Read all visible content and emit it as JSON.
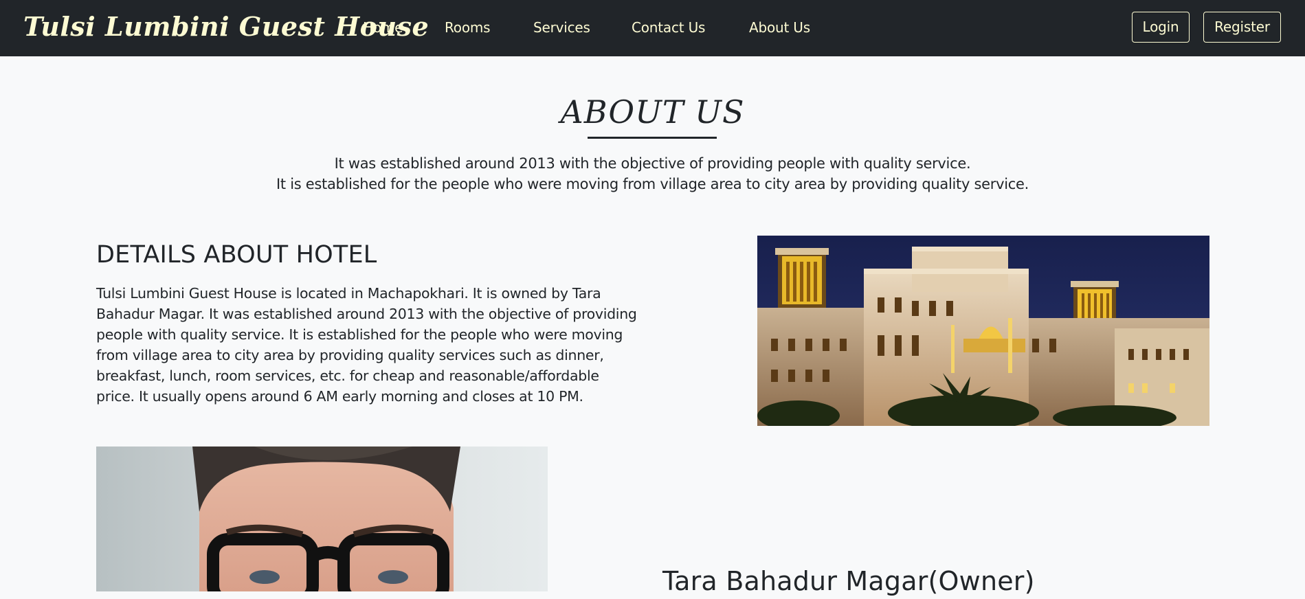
{
  "navbar": {
    "brand": "Tulsi Lumbini Guest House",
    "links": [
      "Home",
      "Rooms",
      "Services",
      "Contact Us",
      "About Us"
    ],
    "login_label": "Login",
    "register_label": "Register"
  },
  "about": {
    "title": "ABOUT US",
    "intro_lines": [
      "It was established around 2013 with the objective of providing people with quality service.",
      "It is established for the people who were moving from village area to city area by providing quality service."
    ]
  },
  "details": {
    "heading": "DETAILS ABOUT HOTEL",
    "lines": [
      "Tulsi Lumbini Guest House is located in Machapokhari. It is owned by Tara",
      "Bahadur Magar. It was established around 2013 with the objective of providing",
      "people with quality service. It is established for the people who were moving",
      "from village area to city area by providing quality services such as dinner,",
      "breakfast, lunch, room services, etc. for cheap and reasonable/affordable",
      "price. It usually opens around 6 AM early morning and closes at 10 PM."
    ]
  },
  "owner": {
    "name": "Tara Bahadur Magar(Owner)"
  },
  "colors": {
    "navbar_bg": "#212529",
    "nav_text": "#fdfbd3",
    "page_bg": "#f8f9fa",
    "text": "#212529"
  }
}
